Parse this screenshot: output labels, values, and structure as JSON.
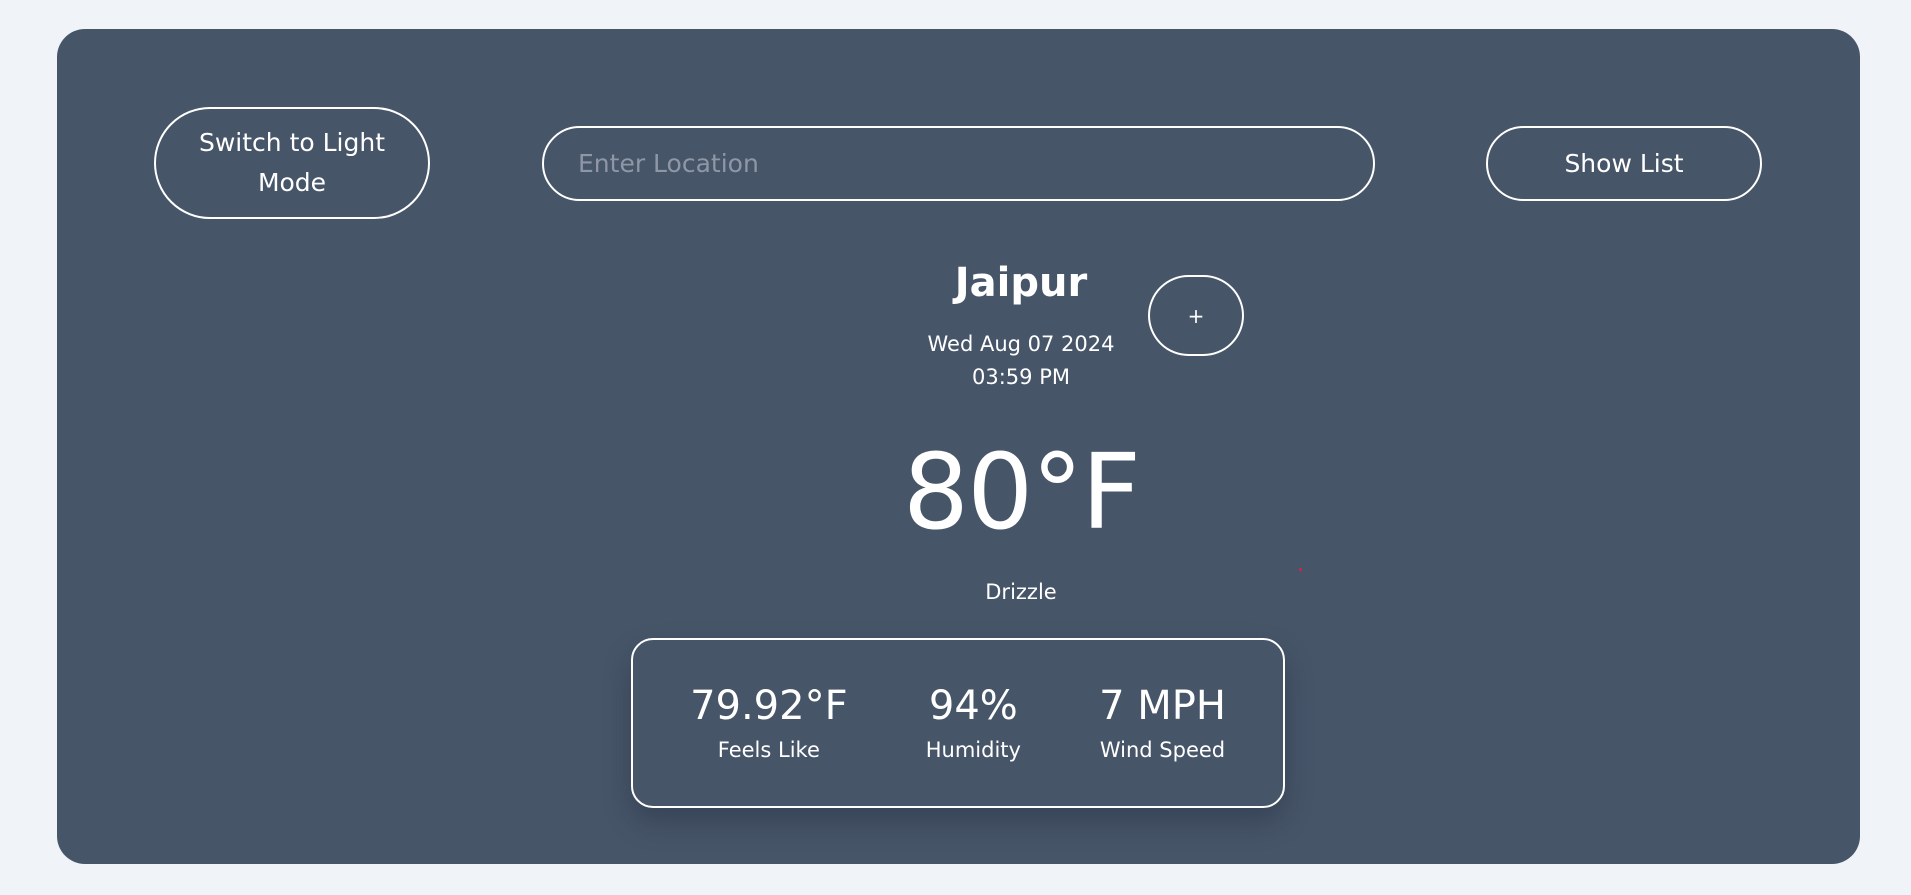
{
  "header": {
    "theme_toggle_label": "Switch to Light Mode",
    "search_placeholder": "Enter Location",
    "search_value": "",
    "show_list_label": "Show List"
  },
  "weather": {
    "city": "Jaipur",
    "date": "Wed Aug 07 2024",
    "time": "03:59 PM",
    "add_label": "+",
    "temperature": "80°F",
    "condition": "Drizzle"
  },
  "stats": [
    {
      "value": "79.92°F",
      "label": "Feels Like"
    },
    {
      "value": "94%",
      "label": "Humidity"
    },
    {
      "value": "7 MPH",
      "label": "Wind Speed"
    }
  ],
  "colors": {
    "page_background": "#f0f4f9",
    "card_background": "#475569",
    "text": "#ffffff",
    "placeholder": "#8d97a6",
    "accent_dot": "#e11d48"
  }
}
